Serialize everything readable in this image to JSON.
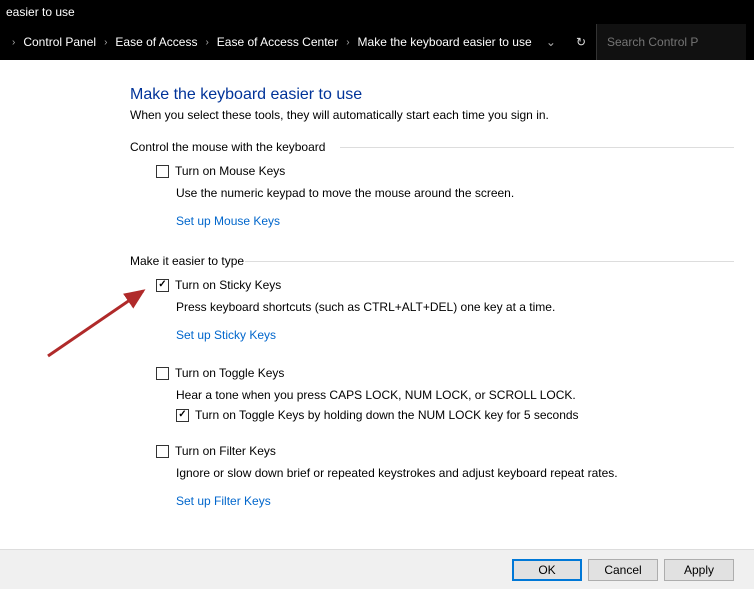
{
  "titlebar": "easier to use",
  "breadcrumb": {
    "items": [
      "Control Panel",
      "Ease of Access",
      "Ease of Access Center",
      "Make the keyboard easier to use"
    ]
  },
  "search": {
    "placeholder": "Search Control P"
  },
  "page": {
    "title": "Make the keyboard easier to use",
    "subtitle": "When you select these tools, they will automatically start each time you sign in."
  },
  "section_mouse": {
    "label": "Control the mouse with the keyboard",
    "chk_label": "Turn on Mouse Keys",
    "chk_checked": false,
    "desc": "Use the numeric keypad to move the mouse around the screen.",
    "link": "Set up Mouse Keys"
  },
  "section_type": {
    "label": "Make it easier to type",
    "sticky": {
      "chk_label": "Turn on Sticky Keys",
      "chk_checked": true,
      "desc": "Press keyboard shortcuts (such as CTRL+ALT+DEL) one key at a time.",
      "link": "Set up Sticky Keys"
    },
    "toggle": {
      "chk_label": "Turn on Toggle Keys",
      "chk_checked": false,
      "desc": "Hear a tone when you press CAPS LOCK, NUM LOCK, or SCROLL LOCK.",
      "hold_chk_label": "Turn on Toggle Keys by holding down the NUM LOCK key for 5 seconds",
      "hold_chk_checked": true
    },
    "filter": {
      "chk_label": "Turn on Filter Keys",
      "chk_checked": false,
      "desc": "Ignore or slow down brief or repeated keystrokes and adjust keyboard repeat rates.",
      "link": "Set up Filter Keys"
    }
  },
  "footer": {
    "ok": "OK",
    "cancel": "Cancel",
    "apply": "Apply"
  }
}
